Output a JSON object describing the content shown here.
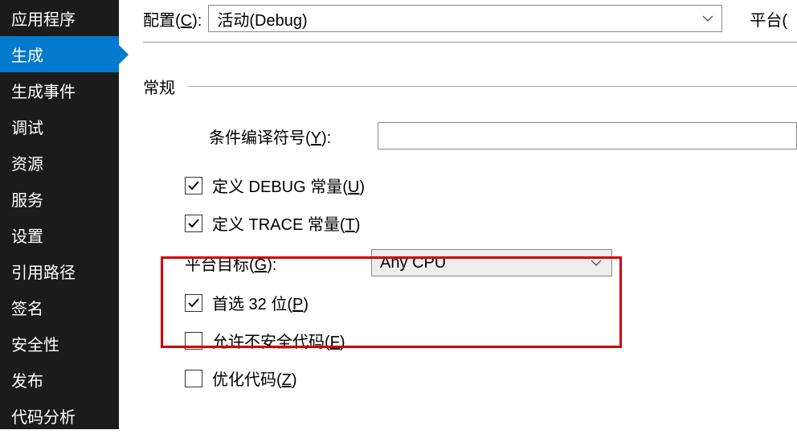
{
  "sidebar": {
    "items": [
      {
        "label": "应用程序"
      },
      {
        "label": "生成"
      },
      {
        "label": "生成事件"
      },
      {
        "label": "调试"
      },
      {
        "label": "资源"
      },
      {
        "label": "服务"
      },
      {
        "label": "设置"
      },
      {
        "label": "引用路径"
      },
      {
        "label": "签名"
      },
      {
        "label": "安全性"
      },
      {
        "label": "发布"
      },
      {
        "label": "代码分析"
      }
    ]
  },
  "top": {
    "config_label_prefix": "配置(",
    "config_label_mnem": "C",
    "config_label_suffix": "):",
    "config_value": "活动(Debug)",
    "platform_label": "平台("
  },
  "section": {
    "title": "常规",
    "symbols_label_prefix": "条件编译符号(",
    "symbols_label_mnem": "Y",
    "symbols_label_suffix": "):",
    "debug_prefix": "定义 DEBUG 常量(",
    "debug_mnem": "U",
    "debug_suffix": ")",
    "trace_prefix": "定义 TRACE 常量(",
    "trace_mnem": "T",
    "trace_suffix": ")",
    "platform_target_prefix": "平台目标(",
    "platform_target_mnem": "G",
    "platform_target_suffix": "):",
    "platform_target_value": "Any CPU",
    "prefer32_prefix": "首选 32 位(",
    "prefer32_mnem": "P",
    "prefer32_suffix": ")",
    "unsafe_prefix": "允许不安全代码(",
    "unsafe_mnem": "F",
    "unsafe_suffix": ")",
    "optimize_prefix": "优化代码(",
    "optimize_mnem": "Z",
    "optimize_suffix": ")"
  }
}
